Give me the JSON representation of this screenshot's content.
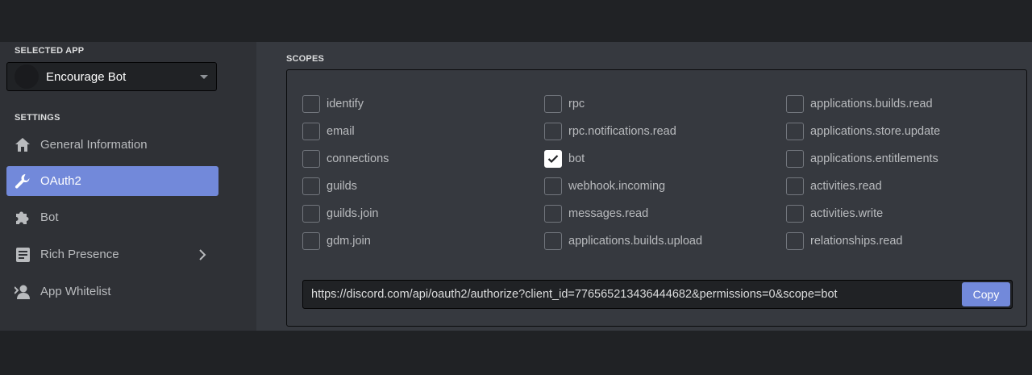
{
  "sidebar": {
    "selected_app_label": "SELECTED APP",
    "app_name": "Encourage Bot",
    "settings_label": "SETTINGS",
    "items": [
      {
        "label": "General Information",
        "icon": "home-icon",
        "active": false
      },
      {
        "label": "OAuth2",
        "icon": "wrench-icon",
        "active": true
      },
      {
        "label": "Bot",
        "icon": "puzzle-icon",
        "active": false
      },
      {
        "label": "Rich Presence",
        "icon": "document-icon",
        "active": false,
        "has_chevron": true
      },
      {
        "label": "App Whitelist",
        "icon": "user-icon",
        "active": false
      }
    ]
  },
  "main": {
    "scopes_label": "SCOPES",
    "scopes": {
      "col1": [
        "identify",
        "email",
        "connections",
        "guilds",
        "guilds.join",
        "gdm.join"
      ],
      "col2": [
        "rpc",
        "rpc.notifications.read",
        "bot",
        "webhook.incoming",
        "messages.read",
        "applications.builds.upload"
      ],
      "col3": [
        "applications.builds.read",
        "applications.store.update",
        "applications.entitlements",
        "activities.read",
        "activities.write",
        "relationships.read"
      ]
    },
    "checked": [
      "bot"
    ],
    "url": "https://discord.com/api/oauth2/authorize?client_id=776565213436444682&permissions=0&scope=bot",
    "copy_label": "Copy"
  },
  "colors": {
    "accent": "#7289da",
    "sidebar_bg": "#2f3136",
    "main_bg": "#36393f",
    "input_bg": "#202225"
  }
}
